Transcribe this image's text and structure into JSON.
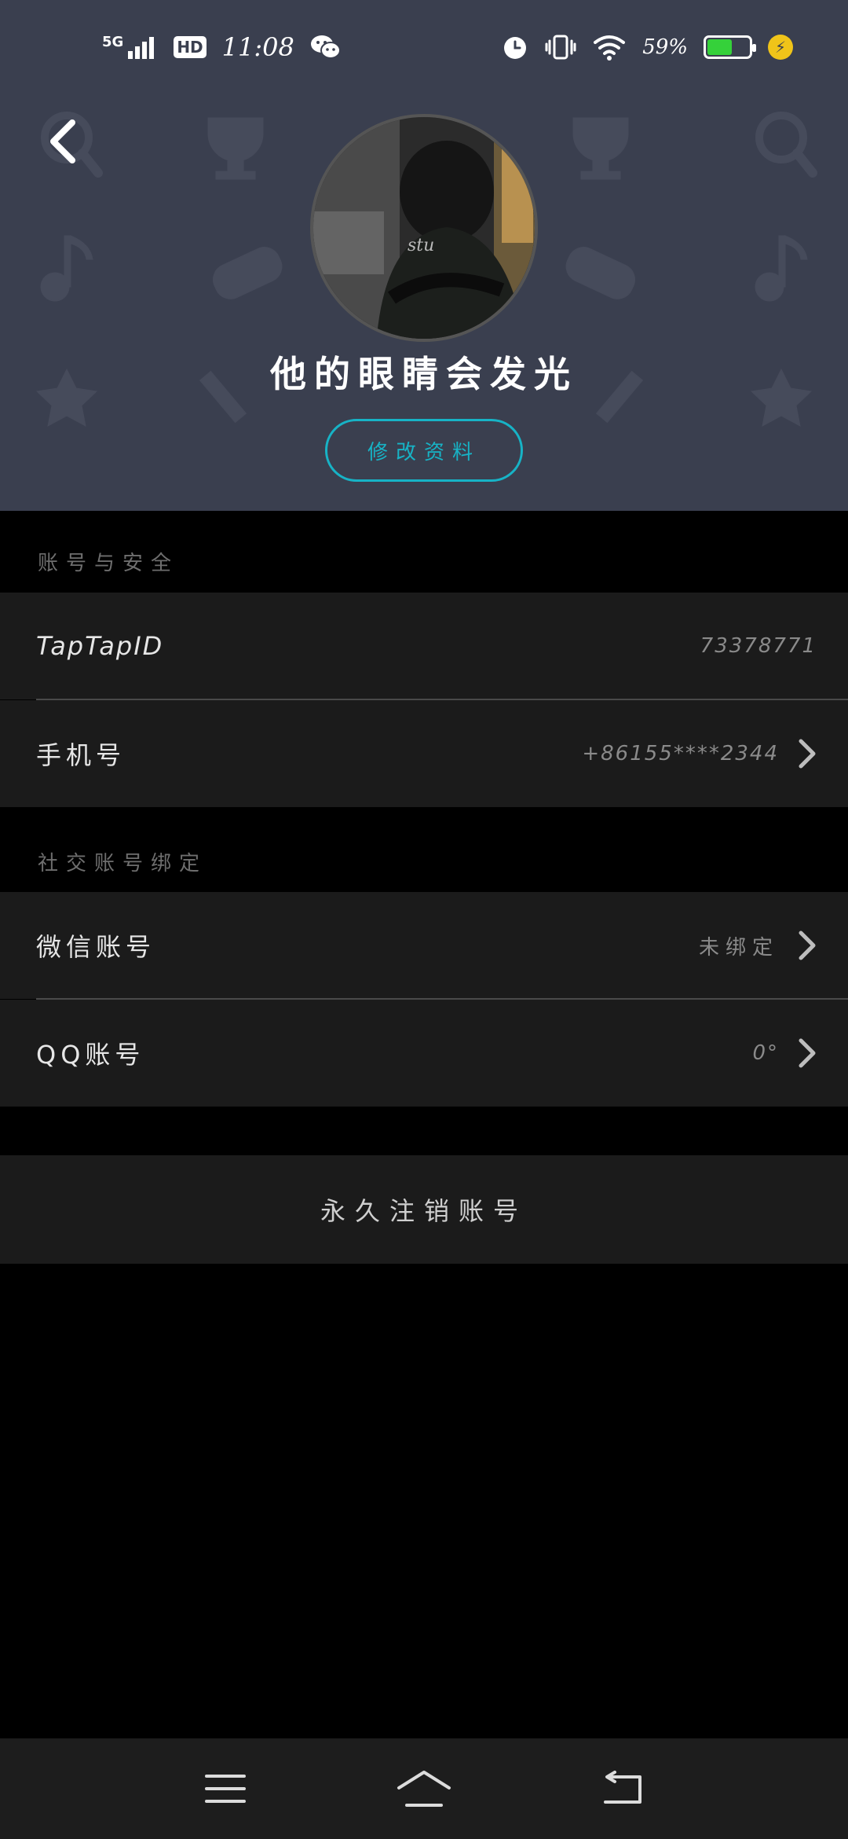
{
  "status_bar": {
    "network": "5G",
    "hd_badge": "HD",
    "time": "11:08",
    "battery_percent": "59%",
    "battery_level": 0.59,
    "icons": [
      "signal-icon",
      "wechat-icon",
      "alarm-icon",
      "vibrate-icon",
      "wifi-icon",
      "battery-icon",
      "charging-icon"
    ]
  },
  "header": {
    "back_icon": "chevron-left-icon",
    "username": "他的眼睛会发光",
    "edit_button": "修改资料"
  },
  "account_security": {
    "section_title": "账号与安全",
    "rows": [
      {
        "label": "TapTapID",
        "value": "73378771",
        "has_chevron": false
      },
      {
        "label": "手机号",
        "value": "+86155****2344",
        "has_chevron": true
      }
    ]
  },
  "social_binding": {
    "section_title": "社交账号绑定",
    "rows": [
      {
        "label": "微信账号",
        "value": "未绑定",
        "has_chevron": true
      },
      {
        "label": "QQ账号",
        "value": "0°",
        "has_chevron": true
      }
    ]
  },
  "danger": {
    "label": "永久注销账号"
  },
  "nav_bar": {
    "icons": [
      "menu-icon",
      "home-icon",
      "back-icon"
    ]
  },
  "colors": {
    "header_bg": "#3a3f4f",
    "accent": "#17b3c6",
    "row_bg": "#1b1b1b",
    "page_bg": "#000000"
  }
}
